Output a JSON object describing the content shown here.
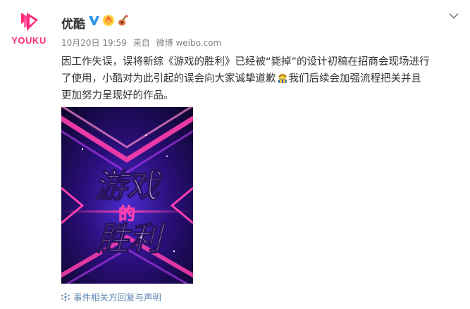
{
  "account": {
    "avatar_text": "YOUKU",
    "name": "优酷",
    "badges": [
      "verified-v-icon",
      "sunflower-badge-icon",
      "guitar-badge-icon"
    ]
  },
  "post": {
    "date": "10月20日 19:59",
    "source_prefix": "来自",
    "source": "微博 weibo.com",
    "text_line1": "因工作失误，误将新综《游戏的胜利》已经被“毙掉”的设计初稿在招商会现场进行",
    "text_line2_before_emoji": "了使用，小酷对为此引起的误会向大家诚挚道歉",
    "emoji": "bow-emoji-icon",
    "text_line2_after_emoji": "我们后续会加强流程把关并且",
    "text_line3": "更加努力呈现好的作品。"
  },
  "image": {
    "title_line1": "游戏",
    "title_line2": "的",
    "title_line3": "胜利",
    "colors": {
      "background": "#1a0a44",
      "pink": "#ff3fae",
      "purple": "#7b3cff"
    }
  },
  "link": {
    "icon": "link-icon",
    "label": "事件相关方回复与声明",
    "color": "#5b84b0"
  },
  "controls": {
    "collapse_icon": "chevron-down-icon"
  }
}
